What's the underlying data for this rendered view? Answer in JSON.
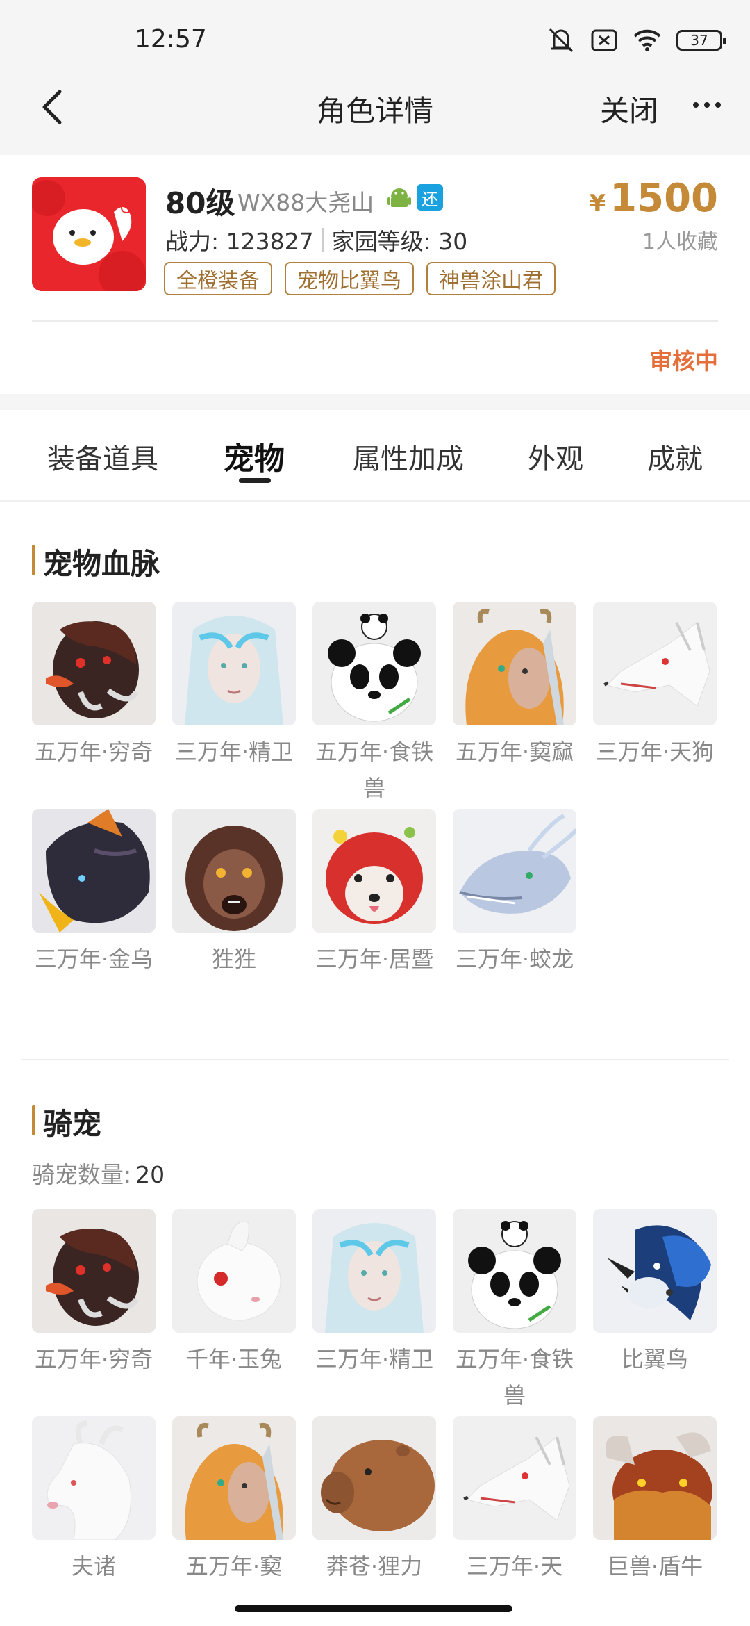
{
  "status_bar": {
    "time": "12:57",
    "battery": "37"
  },
  "header": {
    "title": "角色详情",
    "close_label": "关闭"
  },
  "account": {
    "level": "80级",
    "server": "WX88大尧山",
    "return_badge": "还",
    "power_label": "战力: 123827",
    "home_label": "家园等级: 30",
    "tags": [
      "全橙装备",
      "宠物比翼鸟",
      "神兽涂山君"
    ],
    "currency": "¥",
    "price": "1500",
    "favorites": "1人收藏",
    "status": "审核中"
  },
  "tabs": [
    {
      "label": "装备道具",
      "active": false
    },
    {
      "label": "宠物",
      "active": true
    },
    {
      "label": "属性加成",
      "active": false
    },
    {
      "label": "外观",
      "active": false
    },
    {
      "label": "成就",
      "active": false
    }
  ],
  "pet_bloodline": {
    "title": "宠物血脉",
    "items": [
      {
        "name": "五万年·穷奇",
        "icon": "qiongqi-portrait"
      },
      {
        "name": "三万年·精卫",
        "icon": "jingwei-portrait"
      },
      {
        "name": "五万年·食铁兽",
        "icon": "panda-portrait"
      },
      {
        "name": "五万年·窫窳",
        "icon": "yayu-portrait"
      },
      {
        "name": "三万年·天狗",
        "icon": "tiangou-portrait"
      },
      {
        "name": "三万年·金乌",
        "icon": "jinwu-portrait"
      },
      {
        "name": "狌狌",
        "icon": "xingxing-portrait"
      },
      {
        "name": "三万年·居暨",
        "icon": "juji-portrait"
      },
      {
        "name": "三万年·蛟龙",
        "icon": "jiaolong-portrait"
      }
    ]
  },
  "mounts": {
    "title": "骑宠",
    "count_label": "骑宠数量:",
    "count": "20",
    "items": [
      {
        "name": "五万年·穷奇",
        "icon": "qiongqi-portrait"
      },
      {
        "name": "千年·玉兔",
        "icon": "rabbit-portrait"
      },
      {
        "name": "三万年·精卫",
        "icon": "jingwei-portrait"
      },
      {
        "name": "五万年·食铁兽",
        "icon": "panda-portrait"
      },
      {
        "name": "比翼鸟",
        "icon": "biyiniao-portrait"
      },
      {
        "name": "夫诸",
        "icon": "fuzhu-portrait"
      },
      {
        "name": "五万年·窫",
        "icon": "yayu-portrait"
      },
      {
        "name": "莽苍·狸力",
        "icon": "capybara-portrait"
      },
      {
        "name": "三万年·天",
        "icon": "tiangou-portrait"
      },
      {
        "name": "巨兽·盾牛",
        "icon": "shield-ox-portrait"
      }
    ]
  },
  "colors": {
    "accent_gold": "#c48a38",
    "status_orange": "#e46f3a",
    "avatar_red": "#e8262c",
    "badge_blue": "#1aa1e0"
  }
}
